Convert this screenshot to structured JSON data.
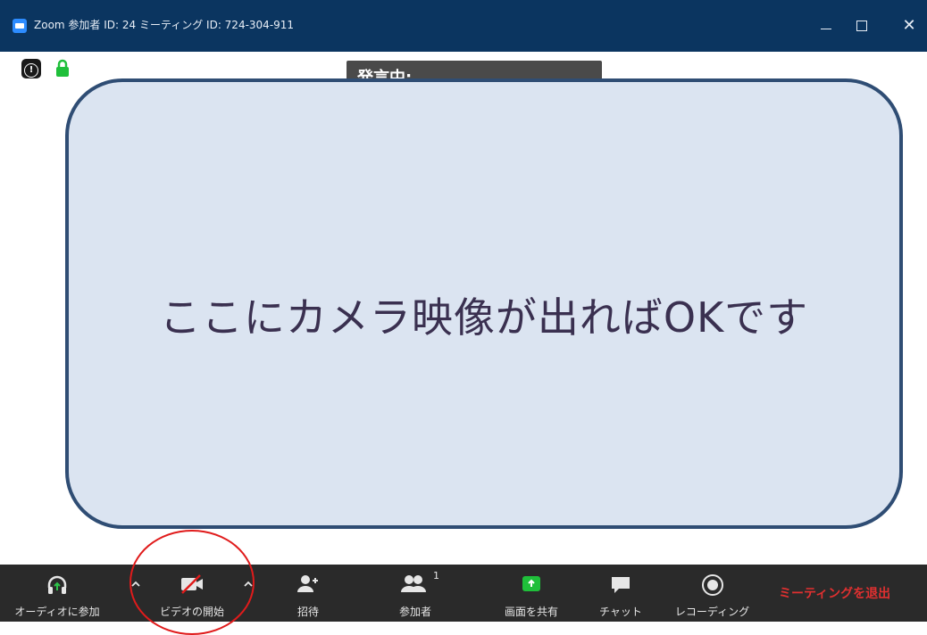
{
  "window": {
    "title": "Zoom 参加者 ID: 24 ミーティング ID: 724-304-911"
  },
  "meeting": {
    "speaking_label": "発言中:",
    "camera_message": "ここにカメラ映像が出ればOKです"
  },
  "toolbar": {
    "items": [
      {
        "label": "オーディオに参加",
        "icon": "headphones-icon"
      },
      {
        "label": "ビデオの開始",
        "icon": "video-off-icon"
      },
      {
        "label": "招待",
        "icon": "invite-icon"
      },
      {
        "label": "参加者",
        "icon": "participants-icon",
        "count": "1"
      },
      {
        "label": "画面を共有",
        "icon": "share-screen-icon"
      },
      {
        "label": "チャット",
        "icon": "chat-icon"
      },
      {
        "label": "レコーディング",
        "icon": "record-icon"
      }
    ],
    "leave_label": "ミーティングを退出"
  },
  "colors": {
    "titlebar": "#0b3560",
    "toolbar": "#2a2a2a",
    "share_green": "#1fbf3a",
    "leave_red": "#e03030",
    "highlight": "#e01b1b",
    "placeholder_fill": "#dbe4f1",
    "placeholder_border": "#2f4d74"
  }
}
